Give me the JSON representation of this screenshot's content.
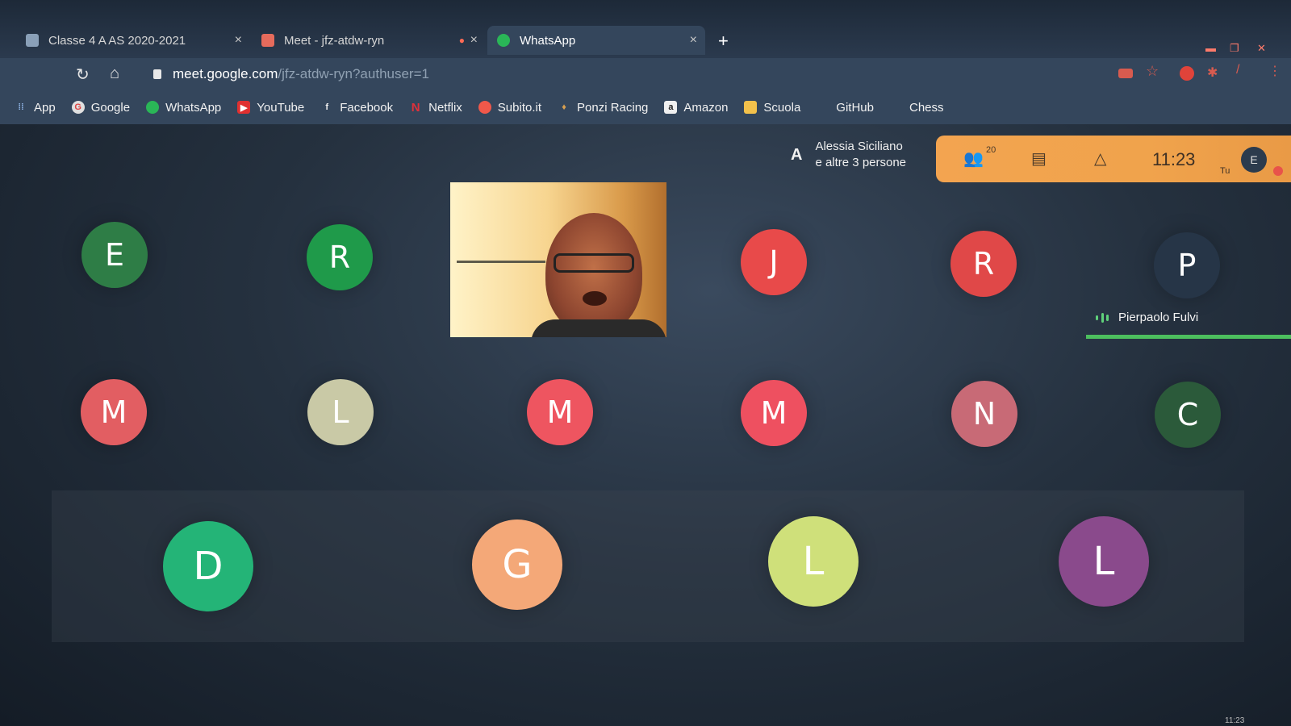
{
  "browser": {
    "tabs": [
      {
        "label": "Classe 4 A AS 2020-2021",
        "close": "×"
      },
      {
        "label": "Meet - jfz-atdw-ryn",
        "close": "×"
      },
      {
        "label": "WhatsApp",
        "close": "×"
      }
    ],
    "new_tab": "+",
    "url_host": "meet.google.com",
    "url_path": "/jfz-atdw-ryn?authuser=1",
    "bookmarks": [
      {
        "label": "App",
        "icon": "apps-grid-icon",
        "color": "#4a6fa5"
      },
      {
        "label": "Google",
        "icon": "google-icon",
        "color": "#e0e0e0"
      },
      {
        "label": "WhatsApp",
        "icon": "whatsapp-icon",
        "color": "#2ab657"
      },
      {
        "label": "YouTube",
        "icon": "youtube-icon",
        "color": "#e03030"
      },
      {
        "label": "Facebook",
        "icon": "facebook-icon",
        "color": "#3b5998"
      },
      {
        "label": "Netflix",
        "icon": "netflix-icon",
        "color": "#d81f26"
      },
      {
        "label": "Subito.it",
        "icon": "subito-icon",
        "color": "#f0584a"
      },
      {
        "label": "Ponzi Racing",
        "icon": "ponzi-racing-icon",
        "color": "#d8a050"
      },
      {
        "label": "Amazon",
        "icon": "amazon-icon",
        "color": "#f0f0f0"
      },
      {
        "label": "Scuola",
        "icon": "folder-icon",
        "color": "#f3c14b"
      },
      {
        "label": "GitHub",
        "icon": "folder-icon",
        "color": "#f3c14b"
      },
      {
        "label": "Chess",
        "icon": "folder-icon",
        "color": "#f3c14b"
      }
    ]
  },
  "meet": {
    "presenter_letter": "A",
    "presenter_line1": "Alessia Siciliano",
    "presenter_line2": "e altre 3 persone",
    "people_count": "20",
    "clock": "11:23",
    "you_label": "Tu",
    "self_initial": "E",
    "speaker_name": "Pierpaolo Fulvi",
    "participants_row1": [
      {
        "initial": "E",
        "color": "#2e7d46"
      },
      {
        "initial": "R",
        "color": "#1f9a4a"
      },
      {
        "initial": "J",
        "color": "#e84a4a"
      },
      {
        "initial": "R",
        "color": "#e04848"
      },
      {
        "initial": "P",
        "color": "#263547"
      }
    ],
    "participants_row2": [
      {
        "initial": "M",
        "color": "#e25e62"
      },
      {
        "initial": "L",
        "color": "#c9c9a6"
      },
      {
        "initial": "M",
        "color": "#ee5560"
      },
      {
        "initial": "M",
        "color": "#ee5060"
      },
      {
        "initial": "N",
        "color": "#c86a76"
      },
      {
        "initial": "C",
        "color": "#2b5a3a"
      }
    ],
    "participants_row3": [
      {
        "initial": "D",
        "color": "#24b477"
      },
      {
        "initial": "G",
        "color": "#f4a878"
      },
      {
        "initial": "L",
        "color": "#cfe07a"
      },
      {
        "initial": "L",
        "color": "#8a4a8c"
      }
    ]
  },
  "taskbar_time": "11:23"
}
